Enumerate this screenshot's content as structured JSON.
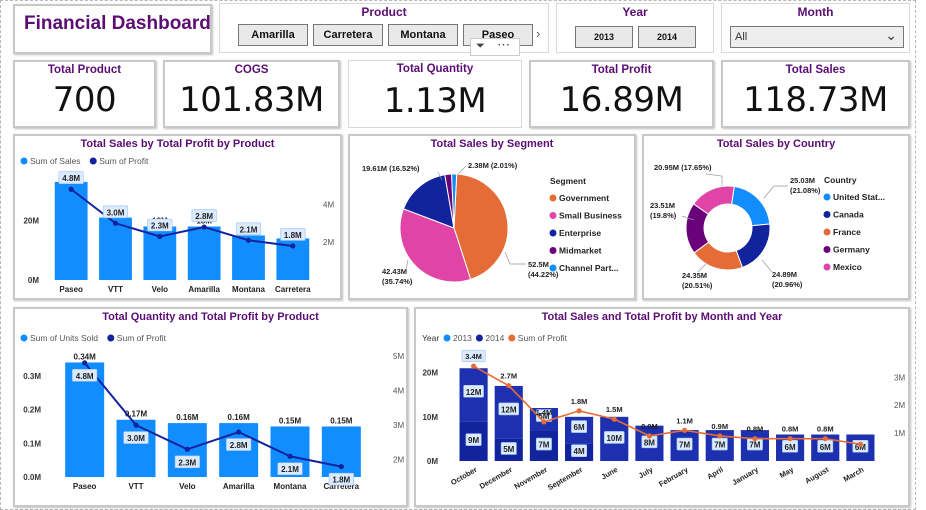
{
  "header": {
    "title": "Financial Dashboard"
  },
  "slicers": {
    "product": {
      "title": "Product",
      "options": [
        "Amarilla",
        "Carretera",
        "Montana",
        "Paseo"
      ]
    },
    "year": {
      "title": "Year",
      "options": [
        "2013",
        "2014"
      ]
    },
    "month": {
      "title": "Month",
      "selected": "All"
    }
  },
  "kpis": [
    {
      "label": "Total Product",
      "value": "700"
    },
    {
      "label": "COGS",
      "value": "101.83M"
    },
    {
      "label": "Total Quantity",
      "value": "1.13M"
    },
    {
      "label": "Total Profit",
      "value": "16.89M"
    },
    {
      "label": "Total Sales",
      "value": "118.73M"
    }
  ],
  "colors": {
    "sales": "#118dff",
    "profit": "#12239e",
    "y2013": "#12239e",
    "y2014": "#1d30b0",
    "line2": "#e66c37",
    "title": "#5b0d73"
  },
  "chart_data": [
    {
      "id": "sales_profit_product",
      "type": "bar",
      "title": "Total Sales by Total Profit by Product",
      "legend": [
        "Sum of  Sales",
        "Sum of Profit"
      ],
      "categories": [
        "Paseo",
        "VTT",
        "Velo",
        "Amarilla",
        "Montana",
        "Carretera"
      ],
      "series": [
        {
          "name": "Sum of  Sales",
          "values": [
            33,
            21,
            18,
            18,
            15,
            14
          ],
          "labels": [
            "33M",
            "21M",
            "18M",
            "18M",
            "15M",
            "14M"
          ]
        },
        {
          "name": "Sum of Profit",
          "values": [
            4.8,
            3.0,
            2.3,
            2.8,
            2.1,
            1.8
          ],
          "labels": [
            "4.8M",
            "3.0M",
            "2.3M",
            "2.8M",
            "2.1M",
            "1.8M"
          ]
        }
      ],
      "y_ticks": [
        "0M",
        "20M"
      ],
      "y2_ticks": [
        "2M",
        "4M"
      ],
      "ylim": [
        0,
        35
      ],
      "y2lim": [
        0,
        5.5
      ]
    },
    {
      "id": "sales_segment",
      "type": "pie",
      "title": "Total Sales by Segment",
      "legend_title": "Segment",
      "slices": [
        {
          "name": "Government",
          "value": 52.5,
          "label": "52.5M",
          "pct": "(44.22%)",
          "color": "#e66c37"
        },
        {
          "name": "Small Business",
          "value": 42.43,
          "label": "42.43M",
          "pct": "(35.74%)",
          "color": "#e044a7"
        },
        {
          "name": "Enterprise",
          "value": 19.61,
          "label": "19.61M (16.52%)",
          "pct": "",
          "color": "#12239e"
        },
        {
          "name": "Midmarket",
          "value": 2.38,
          "label": "2.38M (2.01%)",
          "pct": "",
          "color": "#6b007b"
        },
        {
          "name": "Channel Part...",
          "value": 1.8,
          "label": "",
          "pct": "",
          "color": "#118dff"
        }
      ]
    },
    {
      "id": "sales_country",
      "type": "pie",
      "title": "Total Sales by Country",
      "legend_title": "Country",
      "slices": [
        {
          "name": "United Stat...",
          "value": 25.03,
          "label": "25.03M",
          "pct": "(21.08%)",
          "color": "#118dff"
        },
        {
          "name": "Canada",
          "value": 24.89,
          "label": "24.89M",
          "pct": "(20.96%)",
          "color": "#12239e"
        },
        {
          "name": "France",
          "value": 24.35,
          "label": "24.35M",
          "pct": "(20.51%)",
          "color": "#e66c37"
        },
        {
          "name": "Germany",
          "value": 23.51,
          "label": "23.51M",
          "pct": "(19.8%)",
          "color": "#6b007b"
        },
        {
          "name": "Mexico",
          "value": 20.95,
          "label": "20.95M (17.65%)",
          "pct": "",
          "color": "#e044a7"
        }
      ]
    },
    {
      "id": "qty_profit_product",
      "type": "bar",
      "title": "Total Quantity and Total Profit by Product",
      "legend": [
        "Sum of Units Sold",
        "Sum of Profit"
      ],
      "categories": [
        "Paseo",
        "VTT",
        "Velo",
        "Amarilla",
        "Montana",
        "Carretera"
      ],
      "series": [
        {
          "name": "Sum of Units Sold",
          "values": [
            0.34,
            0.17,
            0.16,
            0.16,
            0.15,
            0.15
          ],
          "labels": [
            "0.34M",
            "0.17M",
            "0.16M",
            "0.16M",
            "0.15M",
            "0.15M"
          ]
        },
        {
          "name": "Sum of Profit",
          "values": [
            4.8,
            3.0,
            2.3,
            2.8,
            2.1,
            1.8
          ],
          "labels": [
            "4.8M",
            "3.0M",
            "2.3M",
            "2.8M",
            "2.1M",
            "1.8M"
          ]
        }
      ],
      "y_ticks": [
        "0.0M",
        "0.1M",
        "0.2M",
        "0.3M"
      ],
      "y2_ticks": [
        "2M",
        "3M",
        "4M",
        "5M"
      ],
      "ylim": [
        0,
        0.38
      ],
      "y2lim": [
        1.5,
        5.2
      ]
    },
    {
      "id": "sales_profit_month_year",
      "type": "bar",
      "title": "Total Sales and Total Profit by Month and Year",
      "legend_title": "Year",
      "legend": [
        "2013",
        "2014",
        "Sum of Profit"
      ],
      "categories": [
        "October",
        "December",
        "November",
        "September",
        "June",
        "July",
        "February",
        "April",
        "January",
        "May",
        "August",
        "March"
      ],
      "series": [
        {
          "name": "2013",
          "values": [
            9,
            5,
            7,
            4,
            0,
            0,
            0,
            0,
            0,
            0,
            0,
            0
          ],
          "labels": [
            "9M",
            "5M",
            "7M",
            "4M",
            "",
            "",
            "",
            "",
            "",
            "",
            "",
            ""
          ]
        },
        {
          "name": "2014",
          "values": [
            12,
            12,
            5,
            6,
            10,
            8,
            7,
            7,
            7,
            6,
            6,
            6
          ],
          "labels": [
            "12M",
            "12M",
            "5M",
            "6M",
            "10M",
            "8M",
            "7M",
            "7M",
            "7M",
            "6M",
            "6M",
            "6M"
          ]
        },
        {
          "name": "Sum of Profit",
          "values": [
            3.4,
            2.7,
            1.4,
            1.8,
            1.5,
            0.9,
            1.1,
            0.9,
            0.8,
            0.8,
            0.8,
            0.6
          ],
          "labels": [
            "3.4M",
            "2.7M",
            "1.4M",
            "1.8M",
            "1.5M",
            "0.9M",
            "1.1M",
            "0.9M",
            "0.8M",
            "0.8M",
            "0.8M",
            ""
          ]
        }
      ],
      "y_ticks": [
        "0M",
        "10M",
        "20M"
      ],
      "y2_ticks": [
        "1M",
        "2M",
        "3M"
      ],
      "ylim": [
        0,
        24
      ],
      "y2lim": [
        0,
        3.8
      ]
    }
  ]
}
